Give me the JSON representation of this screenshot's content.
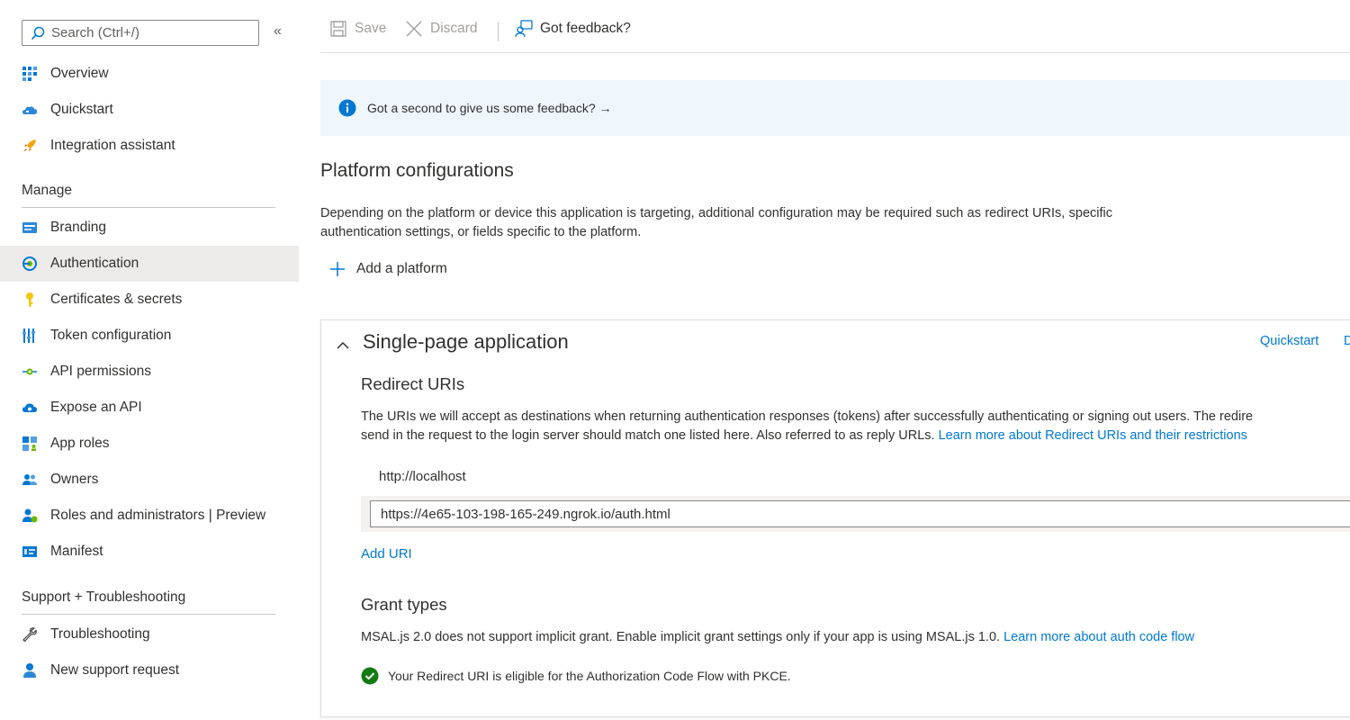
{
  "search": {
    "placeholder": "Search (Ctrl+/)",
    "collapse_glyph": "«"
  },
  "sidebar": {
    "top_items": [
      {
        "label": "Overview",
        "icon": "overview-grid-icon"
      },
      {
        "label": "Quickstart",
        "icon": "quickstart-cloud-icon"
      },
      {
        "label": "Integration assistant",
        "icon": "rocket-icon"
      }
    ],
    "manage_heading": "Manage",
    "manage_items": [
      {
        "label": "Branding",
        "icon": "branding-icon"
      },
      {
        "label": "Authentication",
        "icon": "authentication-icon",
        "active": true
      },
      {
        "label": "Certificates & secrets",
        "icon": "key-icon"
      },
      {
        "label": "Token configuration",
        "icon": "token-bars-icon"
      },
      {
        "label": "API permissions",
        "icon": "api-permissions-icon"
      },
      {
        "label": "Expose an API",
        "icon": "cloud-icon"
      },
      {
        "label": "App roles",
        "icon": "app-roles-icon"
      },
      {
        "label": "Owners",
        "icon": "owners-icon"
      },
      {
        "label": "Roles and administrators | Preview",
        "icon": "roles-admin-icon"
      },
      {
        "label": "Manifest",
        "icon": "manifest-icon"
      }
    ],
    "support_heading": "Support + Troubleshooting",
    "support_items": [
      {
        "label": "Troubleshooting",
        "icon": "wrench-icon"
      },
      {
        "label": "New support request",
        "icon": "support-person-icon"
      }
    ]
  },
  "toolbar": {
    "save_label": "Save",
    "discard_label": "Discard",
    "feedback_label": "Got feedback?"
  },
  "banner": {
    "text": "Got a second to give us some feedback? →"
  },
  "main": {
    "title": "Platform configurations",
    "description": "Depending on the platform or device this application is targeting, additional configuration may be required such as redirect URIs, specific authentication settings, or fields specific to the platform.",
    "add_platform_label": "Add a platform"
  },
  "spa_card": {
    "title": "Single-page application",
    "quickstart_link": "Quickstart",
    "truncated_link": "D",
    "redirect_heading": "Redirect URIs",
    "redirect_desc_line1": "The URIs we will accept as destinations when returning authentication responses (tokens) after successfully authenticating or signing out users. The redire",
    "redirect_desc_line2": "send in the request to the login server should match one listed here. Also referred to as reply URLs.",
    "redirect_learn_more": "Learn more about Redirect URIs and their restrictions",
    "uri_static": "http://localhost",
    "uri_value": "https://4e65-103-198-165-249.ngrok.io/auth.html",
    "add_uri_label": "Add URI",
    "grant_heading": "Grant types",
    "grant_desc": "MSAL.js 2.0 does not support implicit grant. Enable implicit grant settings only if your app is using MSAL.js 1.0.",
    "grant_learn_more": "Learn more about auth code flow",
    "pkce_note": "Your Redirect URI is eligible for the Authorization Code Flow with PKCE."
  },
  "colors": {
    "accent": "#0078d4",
    "active_bg": "#edebe9",
    "banner_bg": "#eff6fc",
    "success": "#107c10"
  }
}
